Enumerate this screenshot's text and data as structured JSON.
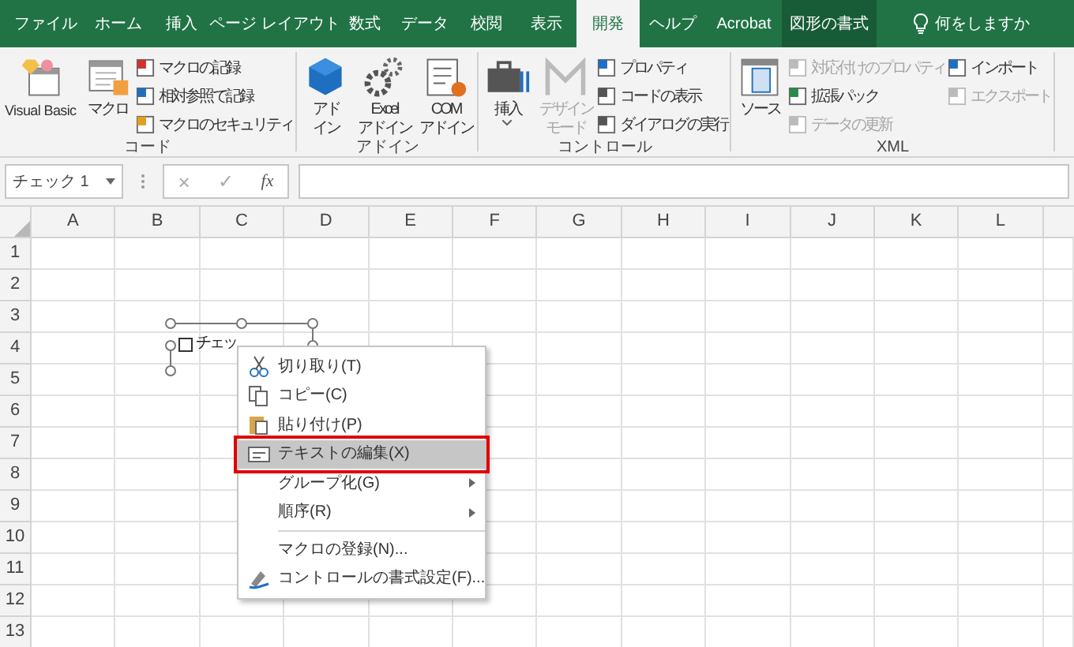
{
  "tabs": [
    {
      "label": "ファイル",
      "kind": "normal",
      "selected": false
    },
    {
      "label": "ホーム",
      "kind": "normal",
      "selected": false
    },
    {
      "label": "挿入",
      "kind": "normal",
      "selected": false
    },
    {
      "label": "ページ レイアウト",
      "kind": "normal",
      "selected": false
    },
    {
      "label": "数式",
      "kind": "normal",
      "selected": false
    },
    {
      "label": "データ",
      "kind": "normal",
      "selected": false
    },
    {
      "label": "校閲",
      "kind": "normal",
      "selected": false
    },
    {
      "label": "表示",
      "kind": "normal",
      "selected": false
    },
    {
      "label": "開発",
      "kind": "normal",
      "selected": true
    },
    {
      "label": "ヘルプ",
      "kind": "normal",
      "selected": false
    },
    {
      "label": "Acrobat",
      "kind": "normal",
      "selected": false
    },
    {
      "label": "図形の書式",
      "kind": "contextual",
      "selected": false
    },
    {
      "label": "何をしますか",
      "kind": "tell_me",
      "selected": false
    }
  ],
  "ribbon": {
    "groups": [
      {
        "label": "コード",
        "controls": [
          {
            "kind": "large",
            "lines": [
              "Visual Basic"
            ],
            "disabled": false,
            "dropdown": false
          },
          {
            "kind": "large",
            "lines": [
              "マクロ"
            ],
            "disabled": false,
            "dropdown": false
          },
          {
            "kind": "column",
            "items": [
              {
                "label": "マクロの記録",
                "disabled": false
              },
              {
                "label": "相対参照で記録",
                "disabled": false
              },
              {
                "label": "マクロのセキュリティ",
                "disabled": false
              }
            ]
          }
        ]
      },
      {
        "label": "アドイン",
        "controls": [
          {
            "kind": "large",
            "lines": [
              "アド",
              "イン"
            ],
            "disabled": false,
            "dropdown": false
          },
          {
            "kind": "large",
            "lines": [
              "Excel",
              "アドイン"
            ],
            "disabled": false,
            "dropdown": false
          },
          {
            "kind": "large",
            "lines": [
              "COM",
              "アドイン"
            ],
            "disabled": false,
            "dropdown": false
          }
        ]
      },
      {
        "label": "コントロール",
        "controls": [
          {
            "kind": "large",
            "lines": [
              "挿入"
            ],
            "disabled": false,
            "dropdown": true
          },
          {
            "kind": "large",
            "lines": [
              "デザイン",
              "モード"
            ],
            "disabled": true,
            "dropdown": false
          },
          {
            "kind": "column",
            "items": [
              {
                "label": "プロパティ",
                "disabled": false
              },
              {
                "label": "コードの表示",
                "disabled": false
              },
              {
                "label": "ダイアログの実行",
                "disabled": false
              }
            ]
          }
        ]
      },
      {
        "label": "XML",
        "controls": [
          {
            "kind": "large",
            "lines": [
              "ソース"
            ],
            "disabled": false,
            "dropdown": false
          },
          {
            "kind": "column",
            "items": [
              {
                "label": "対応付けのプロパティ",
                "disabled": true
              },
              {
                "label": "拡張パック",
                "disabled": false
              },
              {
                "label": "データの更新",
                "disabled": true
              }
            ]
          },
          {
            "kind": "column",
            "items": [
              {
                "label": "インポート",
                "disabled": false
              },
              {
                "label": "エクスポート",
                "disabled": true
              }
            ]
          }
        ]
      }
    ]
  },
  "formula_bar": {
    "name_box": "チェック 1",
    "cancel": "×",
    "enter": "✓",
    "function": "fx"
  },
  "sheet": {
    "columns": [
      "A",
      "B",
      "C",
      "D",
      "E",
      "F",
      "G",
      "H",
      "I",
      "J",
      "K",
      "L"
    ],
    "rows": [
      "1",
      "2",
      "3",
      "4",
      "5",
      "6",
      "7",
      "8",
      "9",
      "10",
      "11",
      "12",
      "13"
    ]
  },
  "checkbox_control": {
    "label": "チェッ",
    "checked": false
  },
  "context_menu": [
    {
      "kind": "item",
      "label": "切り取り(T)",
      "selected": false,
      "submenu": false
    },
    {
      "kind": "item",
      "label": "コピー(C)",
      "selected": false,
      "submenu": false
    },
    {
      "kind": "item",
      "label": "貼り付け(P)",
      "selected": false,
      "submenu": false
    },
    {
      "kind": "item",
      "label": "テキストの編集(X)",
      "selected": true,
      "submenu": false
    },
    {
      "kind": "item",
      "label": "グループ化(G)",
      "selected": false,
      "submenu": true
    },
    {
      "kind": "item",
      "label": "順序(R)",
      "selected": false,
      "submenu": true
    },
    {
      "kind": "separator"
    },
    {
      "kind": "item",
      "label": "マクロの登録(N)...",
      "selected": false,
      "submenu": false
    },
    {
      "kind": "item",
      "label": "コントロールの書式設定(F)...",
      "selected": false,
      "submenu": false
    }
  ]
}
